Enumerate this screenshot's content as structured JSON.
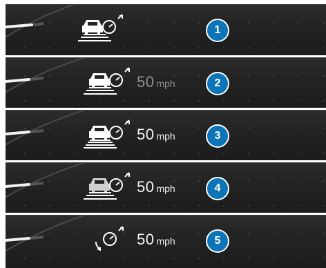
{
  "colors": {
    "panel_background": "#232323",
    "callout_fill": "#0e74b8",
    "callout_border": "#ffffff",
    "speed_text": "#f2f2f2",
    "speed_text_dim": "#8e8e8e"
  },
  "panels": [
    {
      "callout": "1",
      "icon": "vehicle-with-speedometer-lane-icon",
      "speed_value": "",
      "speed_unit": ""
    },
    {
      "callout": "2",
      "icon": "vehicle-with-speedometer-lane-icon",
      "speed_value": "50",
      "speed_unit": "mph"
    },
    {
      "callout": "3",
      "icon": "vehicle-with-speedometer-lane-icon",
      "speed_value": "50",
      "speed_unit": "mph"
    },
    {
      "callout": "4",
      "icon": "vehicle-with-speedometer-lane-icon",
      "speed_value": "50",
      "speed_unit": "mph"
    },
    {
      "callout": "5",
      "icon": "speedometer-icon",
      "speed_value": "50",
      "speed_unit": "mph"
    }
  ]
}
